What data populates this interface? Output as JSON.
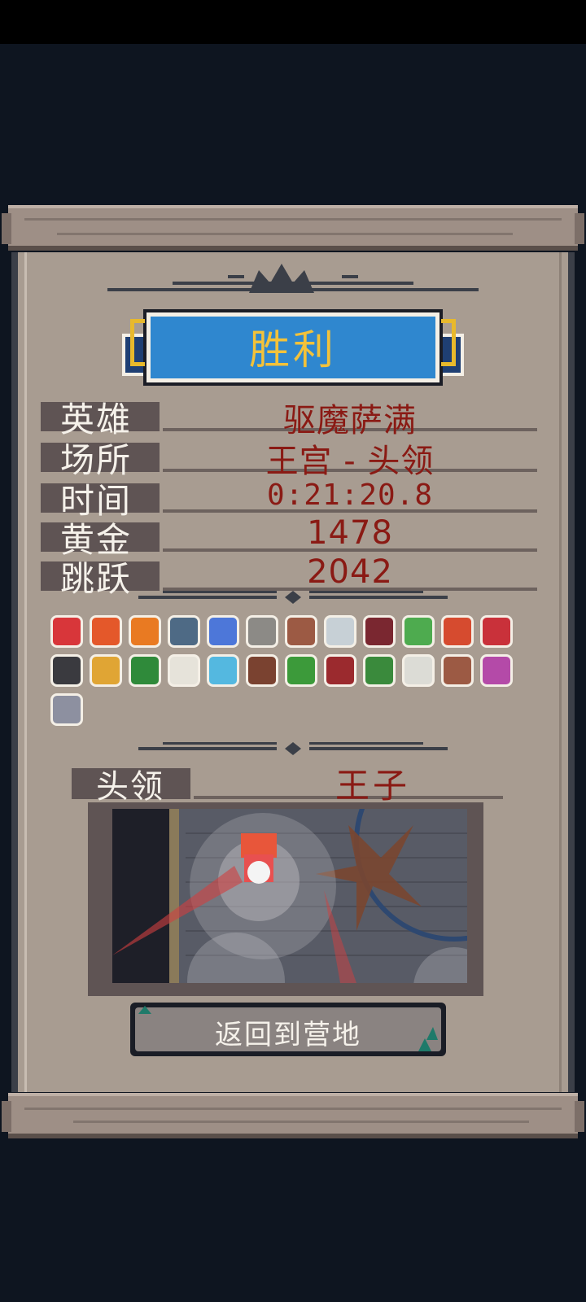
{
  "result": {
    "title": "胜利"
  },
  "stats": [
    {
      "label": "英雄",
      "value": "驱魔萨满"
    },
    {
      "label": "场所",
      "value": "王宫 - 头领"
    },
    {
      "label": "时间",
      "value": "0:21:20.8"
    },
    {
      "label": "黄金",
      "value": "1478"
    },
    {
      "label": "跳跃",
      "value": "2042"
    }
  ],
  "items": [
    {
      "icon": "heart-icon",
      "color": "#d8363a"
    },
    {
      "icon": "fire-feather-icon",
      "color": "#e4582a"
    },
    {
      "icon": "sun-orb-icon",
      "color": "#e97a22"
    },
    {
      "icon": "rune-book-icon",
      "color": "#4e6a85"
    },
    {
      "icon": "lightning-spear-icon",
      "color": "#4d77d9"
    },
    {
      "icon": "stone-tower-icon",
      "color": "#8c8a86"
    },
    {
      "icon": "bone-icon",
      "color": "#9c5a44"
    },
    {
      "icon": "crystal-drop-icon",
      "color": "#c7d0d6"
    },
    {
      "icon": "dark-chest-icon",
      "color": "#7a2730"
    },
    {
      "icon": "recycle-heart-icon",
      "color": "#4eab4f"
    },
    {
      "icon": "horseshoe-magnet-icon",
      "color": "#d64b2f"
    },
    {
      "icon": "microphone-icon",
      "color": "#c9313a"
    },
    {
      "icon": "armor-icon",
      "color": "#3a3a3f"
    },
    {
      "icon": "golden-staff-icon",
      "color": "#e0a534"
    },
    {
      "icon": "clover-icon",
      "color": "#2f8a3a"
    },
    {
      "icon": "bomb-bag-icon",
      "color": "#e6e3da"
    },
    {
      "icon": "blue-wing-icon",
      "color": "#54b8e0"
    },
    {
      "icon": "wooden-stakes-icon",
      "color": "#7a4230"
    },
    {
      "icon": "green-snake-icon",
      "color": "#3c9a3a"
    },
    {
      "icon": "red-pack-icon",
      "color": "#9b2a2e"
    },
    {
      "icon": "green-boot-icon",
      "color": "#3a8a3c"
    },
    {
      "icon": "milk-jar-icon",
      "color": "#dcdcd6"
    },
    {
      "icon": "bone-icon",
      "color": "#9c5a44"
    },
    {
      "icon": "potion-icon",
      "color": "#b44aa8"
    },
    {
      "icon": "silver-dome-icon",
      "color": "#8d90a0"
    }
  ],
  "boss": {
    "label": "头领",
    "value": "王子"
  },
  "button": {
    "label": "返回到营地"
  }
}
